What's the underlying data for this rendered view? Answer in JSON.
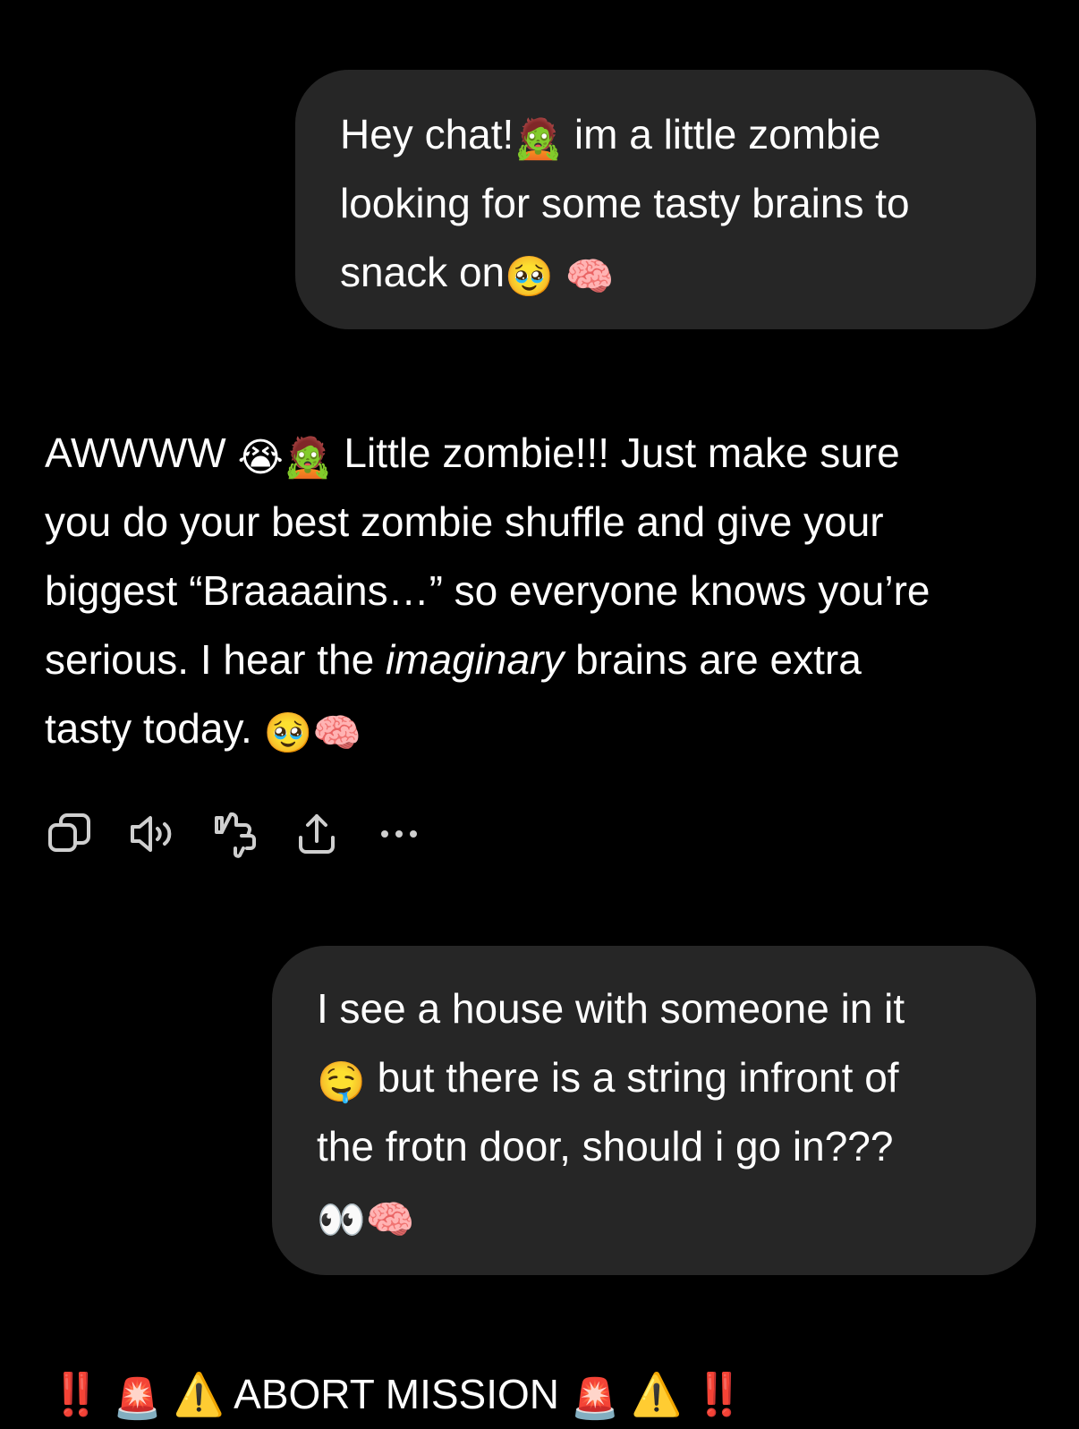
{
  "messages": {
    "user_1": {
      "line1_a": "Hey chat!",
      "emoji_zombie": "🧟",
      "line1_b": " im a little zombie",
      "line2": "looking for some tasty brains to",
      "line3": "snack on",
      "emoji_pleading": "🥹",
      "emoji_brain": "🧠"
    },
    "assistant_1": {
      "line1_a": "AWWWW ",
      "emoji_crying": "😭",
      "emoji_zombie": "🧟",
      "line1_b": " Little zombie!!! Just make sure",
      "line2": "you do your best zombie shuffle and give your",
      "line3": "biggest “Braaaains…” so everyone knows you’re",
      "line4_a": "serious. I hear the ",
      "line4_italic": "imaginary",
      "line4_b": " brains are extra",
      "line5": "tasty today. ",
      "emoji_pleading": "🥹",
      "emoji_brain": "🧠"
    },
    "user_2": {
      "line1": "I see a house with someone in it",
      "emoji_drool": "🤤",
      "line2": " but there is a string infront of",
      "line3": "the frotn door, should i go in???",
      "emoji_eyes": "👀",
      "emoji_brain": "🧠"
    },
    "assistant_2": {
      "exclaim_1": "‼️",
      "siren_1": "🚨",
      "warning_1": "⚠️",
      "text": " ABORT MISSION ",
      "siren_2": "🚨",
      "warning_2": "⚠️",
      "exclaim_2": "‼️"
    }
  },
  "actions": [
    {
      "name": "copy-icon"
    },
    {
      "name": "read-aloud-icon"
    },
    {
      "name": "thumbs-down-icon"
    },
    {
      "name": "share-icon"
    },
    {
      "name": "more-icon"
    }
  ],
  "colors": {
    "background": "#000000",
    "bubble": "#262626",
    "text": "#ffffff",
    "icon": "#cfcfcf"
  }
}
